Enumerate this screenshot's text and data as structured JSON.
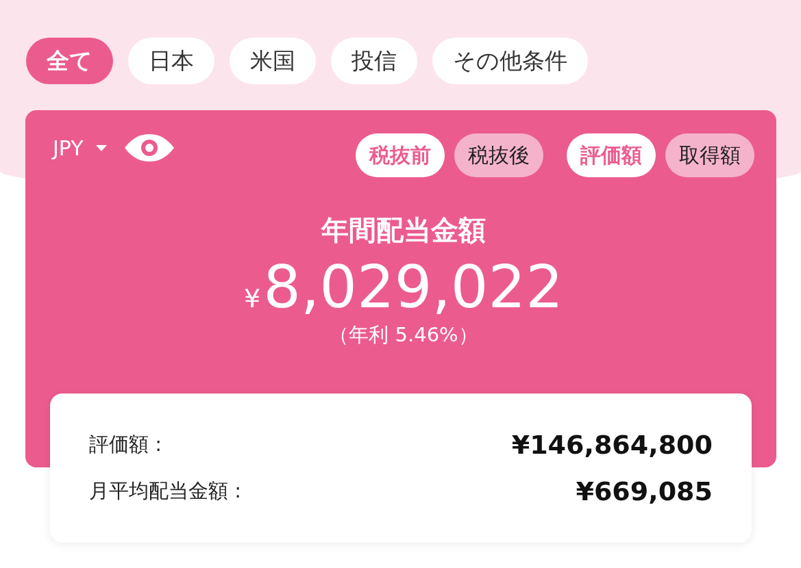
{
  "filter_tabs": [
    {
      "label": "全て",
      "selected": true
    },
    {
      "label": "日本",
      "selected": false
    },
    {
      "label": "米国",
      "selected": false
    },
    {
      "label": "投信",
      "selected": false
    },
    {
      "label": "その他条件",
      "selected": false
    }
  ],
  "card": {
    "currency": "JPY",
    "tax_toggle": [
      {
        "label": "税抜前",
        "selected": true
      },
      {
        "label": "税抜後",
        "selected": false
      }
    ],
    "value_toggle": [
      {
        "label": "評価額",
        "selected": true
      },
      {
        "label": "取得額",
        "selected": false
      }
    ],
    "title": "年間配当金額",
    "currency_symbol": "¥",
    "amount": "8,029,022",
    "yield": "（年利 5.46%）"
  },
  "summary": [
    {
      "label": "評価額 :",
      "value": "¥146,864,800"
    },
    {
      "label": "月平均配当金額 :",
      "value": "¥669,085"
    }
  ]
}
